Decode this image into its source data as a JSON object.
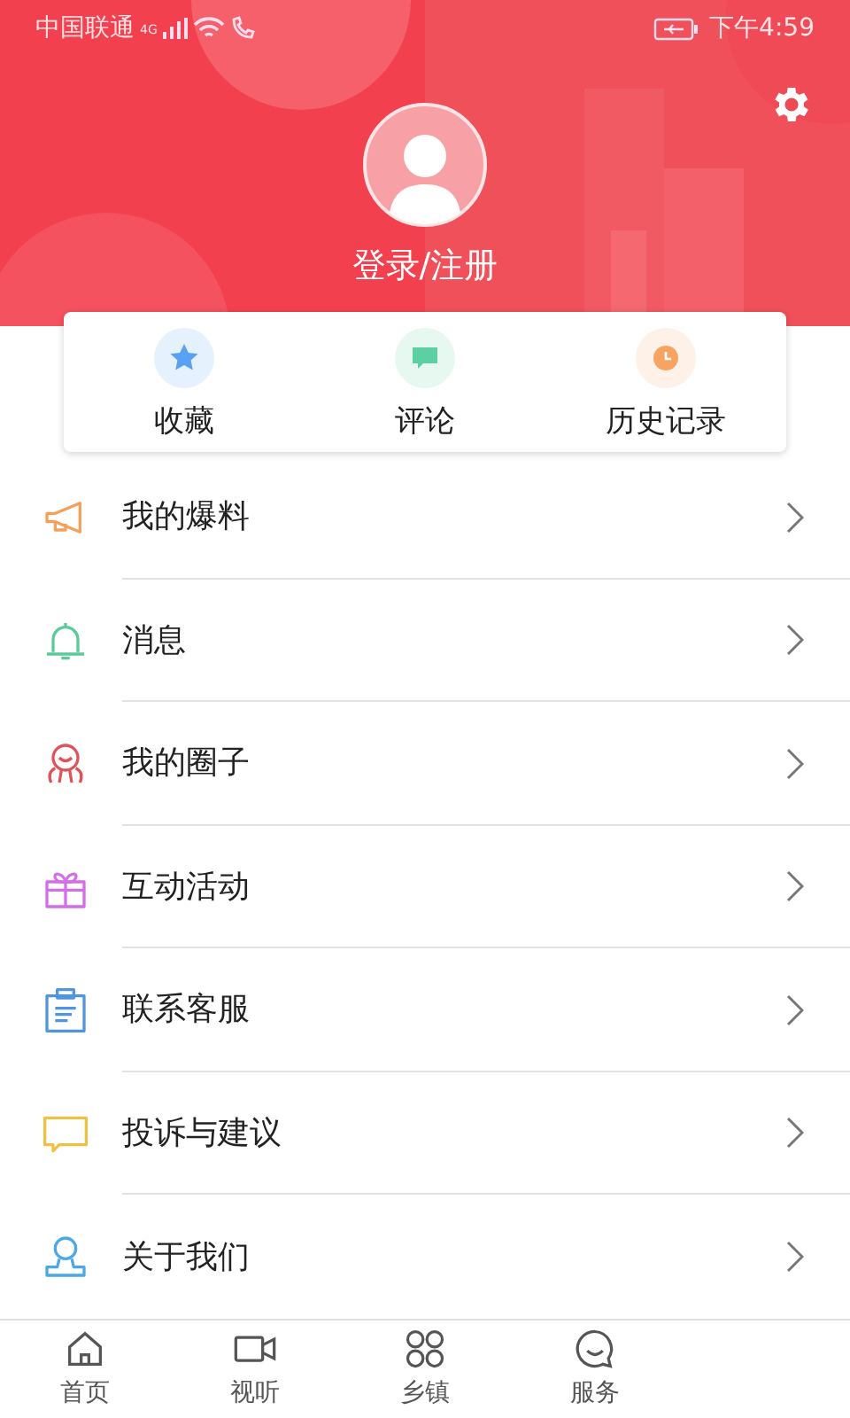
{
  "status_bar": {
    "carrier": "中国联通",
    "network": "4G",
    "time": "下午4:59"
  },
  "profile": {
    "login_label": "登录/注册"
  },
  "shortcuts": [
    {
      "label": "收藏",
      "kind": "star",
      "color": "#5aa0f5"
    },
    {
      "label": "评论",
      "kind": "comment",
      "color": "#5ccfa3"
    },
    {
      "label": "历史记录",
      "kind": "clock",
      "color": "#f7a462"
    }
  ],
  "menu": [
    {
      "label": "我的爆料",
      "kind": "megaphone",
      "color": "#f5a05a"
    },
    {
      "label": "消息",
      "kind": "bell",
      "color": "#5cc99a"
    },
    {
      "label": "我的圈子",
      "kind": "circle",
      "color": "#e0525a"
    },
    {
      "label": "互动活动",
      "kind": "gift",
      "color": "#d46ee8"
    },
    {
      "label": "联系客服",
      "kind": "clipboard",
      "color": "#4f95e0"
    },
    {
      "label": "投诉与建议",
      "kind": "chat",
      "color": "#f0c040"
    },
    {
      "label": "关于我们",
      "kind": "person",
      "color": "#4aa8e8"
    }
  ],
  "tab_bar": [
    {
      "label": "首页",
      "kind": "home",
      "selected": false
    },
    {
      "label": "视听",
      "kind": "video",
      "selected": false
    },
    {
      "label": "乡镇",
      "kind": "grid",
      "selected": false
    },
    {
      "label": "服务",
      "kind": "service",
      "selected": false
    }
  ]
}
